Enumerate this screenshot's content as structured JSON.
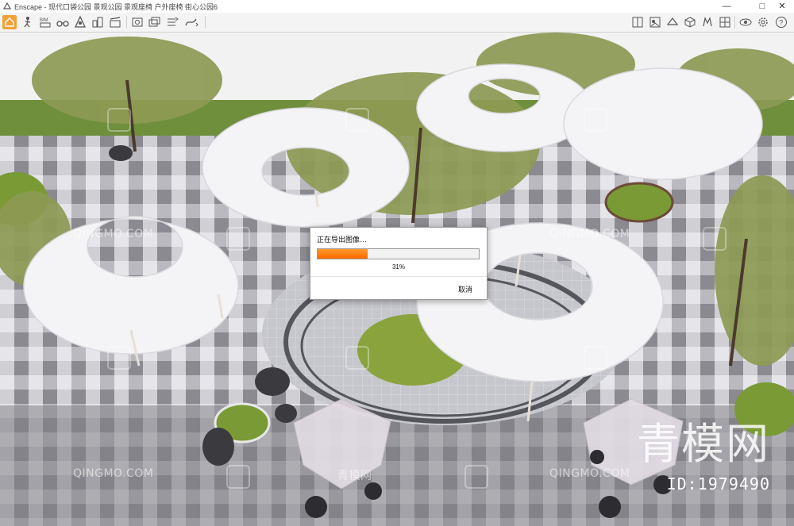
{
  "window": {
    "app_name": "Enscape",
    "title": "Enscape - 现代口袋公园 景观公园 景观座椅 户外座椅 街心公园6",
    "controls": {
      "minimize": "—",
      "maximize": "□",
      "close": "✕"
    }
  },
  "toolbar": {
    "accent": "#f0a23a",
    "left_icons": [
      "home-icon",
      "walk-icon",
      "bim-icon",
      "binoculars-icon",
      "map-pin-icon",
      "buildings-icon",
      "clapper-icon",
      "screenshot-icon",
      "batch-render-icon",
      "export-icon",
      "video-path-icon"
    ],
    "right_icons": [
      "book-icon",
      "asset-library-icon",
      "material-icon",
      "cube-icon",
      "sun-icon",
      "grid-icon",
      "visual-settings-icon",
      "settings-icon",
      "help-icon"
    ]
  },
  "export_dialog": {
    "title": "正在导出图像…",
    "progress_fraction": 0.31,
    "progress_text": "31%",
    "cancel_label": "取消",
    "progress_color": "#ff7a10"
  },
  "watermarks": {
    "site_text": "QINGMO.COM",
    "brand_text": "青模网",
    "id_text": "ID:1979490"
  }
}
